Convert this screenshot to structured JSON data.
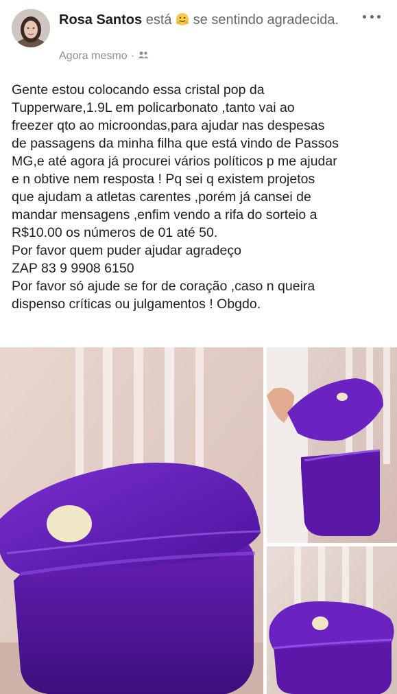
{
  "post": {
    "author": "Rosa Santos",
    "activity_prefix": "está",
    "feeling_text": "se sentindo agradecida.",
    "feeling_emoji": "hugging-face-emoji",
    "timestamp": "Agora mesmo",
    "separator": "·",
    "audience_icon": "friends-icon",
    "more_icon": "more-options-icon",
    "body_lines": [
      "Gente estou colocando essa cristal pop da",
      "Tupperware,1.9L em policarbonato ,tanto vai ao",
      "freezer qto ao microondas,para ajudar nas despesas",
      "de passagens da minha filha que está vindo de Passos",
      "MG,e até agora já procurei vários políticos p me ajudar",
      "e n obtive nem resposta ! Pq sei q existem projetos",
      "que ajudam a atletas carentes ,porém já cansei de",
      "mandar mensagens ,enfim vendo a rifa do sorteio a",
      "R$10.00 os números de 01 até 50.",
      "Por favor quem puder ajudar agradeço",
      "ZAP 83 9 9908 6150",
      "Por favor só ajude se for de coração ,caso n queira",
      "dispenso críticas ou julgamentos ! Obgdo."
    ]
  },
  "colors": {
    "name": "#1c1e21",
    "secondary_text": "#65676b",
    "product_purple": "#5b1aa6",
    "lid_button": "#efe7c5"
  }
}
